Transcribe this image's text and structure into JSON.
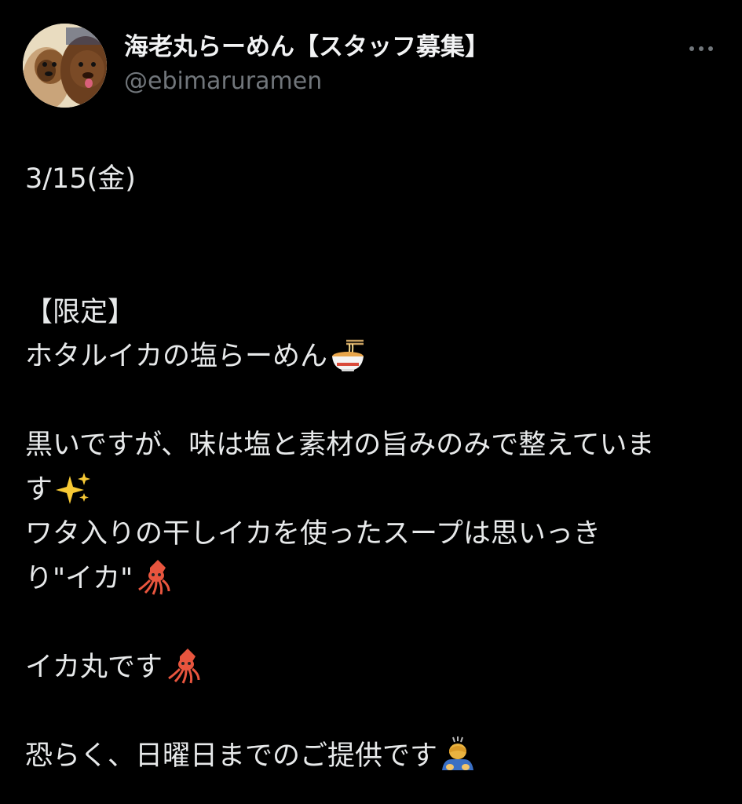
{
  "author": {
    "display_name": "海老丸らーめん【スタッフ募集】",
    "handle": "@ebimaruramen",
    "avatar_icon": "avatar-dogs-photo"
  },
  "menu": {
    "more_icon": "more-horizontal-icon"
  },
  "tweet": {
    "date_line": "3/15(金)",
    "limited_label": "【限定】",
    "dish_name": "ホタルイカの塩らーめん",
    "dish_emoji": "ramen-bowl-emoji",
    "description_line1": "黒いですが、味は塩と素材の旨みのみで整えていま",
    "description_line2": "す",
    "description_line2_emoji": "sparkles-emoji",
    "description_line3": "ワタ入りの干しイカを使ったスープは思いっき",
    "description_line4": "り\"イカ\"",
    "description_line4_emoji": "squid-emoji",
    "ikamaru_line": "イカ丸です",
    "ikamaru_emoji": "squid-emoji",
    "closing_line": "恐らく、日曜日までのご提供です",
    "closing_emoji": "person-bowing-emoji"
  },
  "colors": {
    "background": "#000000",
    "text_primary": "#e7e9ea",
    "text_secondary": "#71767b"
  }
}
